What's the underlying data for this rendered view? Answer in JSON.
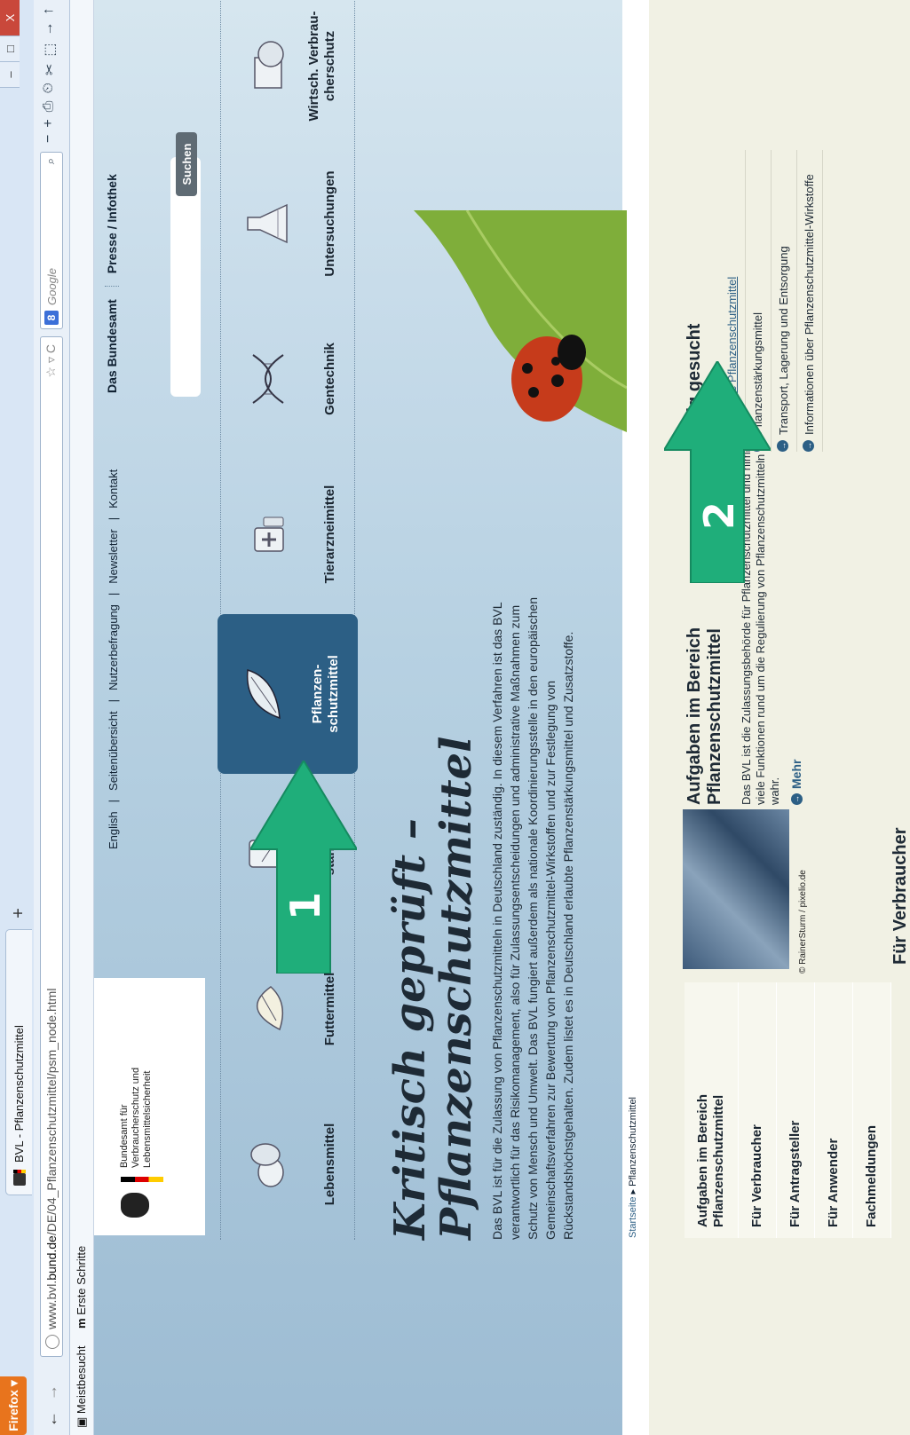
{
  "browser": {
    "menu_label": "Firefox ▾",
    "tab_title": "BVL - Pflanzenschutzmittel",
    "new_tab": "+",
    "window_buttons": [
      "–",
      "□",
      "X"
    ],
    "url_prefix": "www.bvl.",
    "url_domain": "bund.de",
    "url_path": "/DE/04_Pflanzenschutzmittel/psm_node.html",
    "url_tools": "☆ ▿ C",
    "search_engine": "8",
    "search_placeholder": "Google",
    "nav_icons": [
      "−",
      "+",
      "⎙",
      "⏲",
      "✂",
      "⬚",
      "→",
      "↑"
    ]
  },
  "bookmarks": [
    {
      "label": "Meistbesucht"
    },
    {
      "label": "Erste Schritte"
    }
  ],
  "site": {
    "logo_text": [
      "Bundesamt für",
      "Verbraucherschutz und",
      "Lebensmittelsicherheit"
    ],
    "top_links": [
      "English",
      "Seitenübersicht",
      "Nutzerbefragung",
      "Newsletter",
      "Kontakt"
    ],
    "main_nav": [
      "Das Bundesamt",
      "Presse / Infothek"
    ],
    "search_button": "Suchen",
    "categories": [
      {
        "label": "Lebensmittel",
        "icon": "lebensmittel-icon"
      },
      {
        "label": "Futtermittel",
        "icon": "futtermittel-icon"
      },
      {
        "label": "Bedarfsgegen-\nstände",
        "icon": "bedarfsgegenstaende-icon"
      },
      {
        "label": "Pflanzen-\nschutzmittel",
        "icon": "pflanzenschutzmittel-icon"
      },
      {
        "label": "Tierarzneimittel",
        "icon": "tierarzneimittel-icon"
      },
      {
        "label": "Gentechnik",
        "icon": "gentechnik-icon"
      },
      {
        "label": "Untersuchungen",
        "icon": "untersuchungen-icon"
      },
      {
        "label": "Wirtsch. Verbrau-\ncherschutz",
        "icon": "wirtschaft-icon"
      }
    ],
    "hero_title_1": "Kritisch geprüft –",
    "hero_title_2": "Pflanzenschutzmittel",
    "hero_text": "Das BVL ist für die Zulassung von Pflanzenschutzmitteln in Deutschland zuständig. In diesem Verfahren ist das BVL verantwortlich für das Risikomanagement, also für Zulassungsentscheidungen und administrative Maßnahmen zum Schutz von Mensch und Umwelt. Das BVL fungiert außerdem als nationale Koordinierungsstelle in den europäischen Gemeinschaftsverfahren zur Bewertung von Pflanzenschutzmittel-Wirkstoffen und zur Festlegung von Rückstandshöchstgehalten. Zudem listet es in Deutschland erlaubte Pflanzenstärkungsmittel und Zusatzstoffe.",
    "breadcrumb_home": "Startseite",
    "breadcrumb_sep": "▸",
    "breadcrumb_current": "Pflanzenschutzmittel",
    "left_nav": [
      "Aufgaben im Bereich Pflanzenschutzmittel",
      "Für Verbraucher",
      "Für Antragsteller",
      "Für Anwender",
      "Fachmeldungen"
    ],
    "tile_credit": "© RainerSturm / pixelio.de",
    "box_title": "Aufgaben im Bereich Pflanzenschutzmittel",
    "box_text": "Das BVL ist die Zulassungsbehörde für Pflanzenschutzmittel und nimmt viele Funktionen rund um die Regulierung von Pflanzenschutzmitteln wahr.",
    "mehr": "Mehr",
    "freq_title": "Häufig gesucht",
    "freq_items": [
      "Zugelassene Pflanzenschutzmittel",
      "Pflanzenstärkungsmittel",
      "Transport, Lagerung und Entsorgung",
      "Informationen über Pflanzenschutzmittel-Wirkstoffe"
    ],
    "vb_title": "Für Verbraucher"
  },
  "annotations": [
    {
      "number": "1",
      "color": "#1fae7a"
    },
    {
      "number": "2",
      "color": "#1fae7a"
    }
  ],
  "colors": {
    "accent": "#2c5f85",
    "annotation": "#1fae7a",
    "hero_bg": "#b7d1e2",
    "lower_bg": "#f1f1e4"
  }
}
